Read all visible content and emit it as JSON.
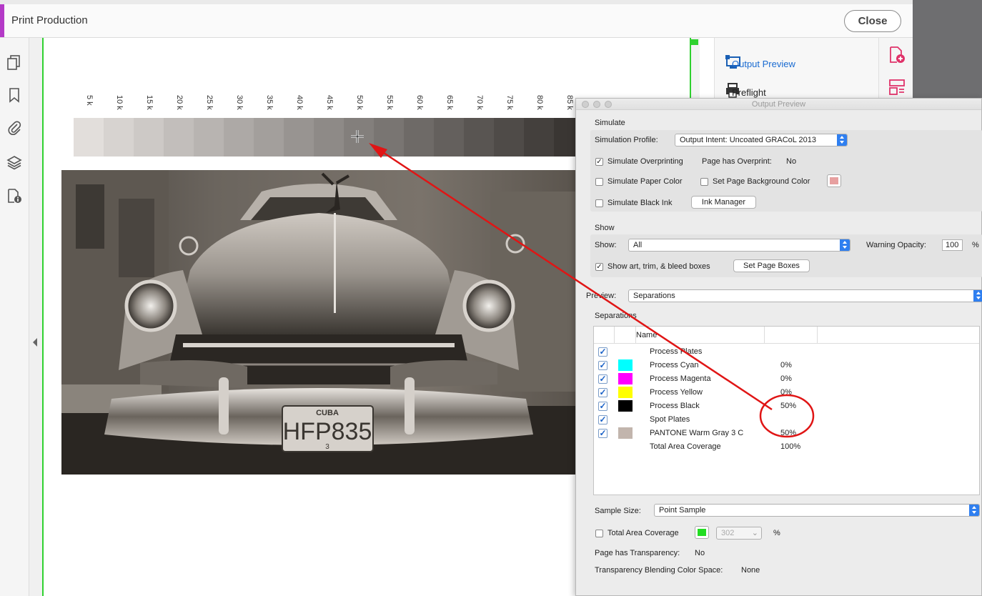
{
  "app": {
    "title": "Print Production",
    "close_label": "Close"
  },
  "left_toolbar": {
    "icons": [
      "pages-icon",
      "bookmark-icon",
      "attachment-icon",
      "layers-icon",
      "document-info-icon"
    ]
  },
  "right_panel": {
    "items": [
      {
        "label": "Output Preview",
        "icon": "output-preview-icon",
        "active": true
      },
      {
        "label": "Preflight",
        "icon": "preflight-icon",
        "active": false
      }
    ]
  },
  "document": {
    "ramp_labels": [
      "5 k",
      "10 k",
      "15 k",
      "20 k",
      "25 k",
      "30 k",
      "35 k",
      "40 k",
      "45 k",
      "50 k",
      "55 k",
      "60 k",
      "65 k",
      "70 k",
      "75 k",
      "80 k",
      "85 k"
    ],
    "plate_text_top": "CUBA",
    "plate_text_main": "HFP835",
    "plate_text_bottom": "3"
  },
  "dialog": {
    "title": "Output Preview",
    "simulate": {
      "title": "Simulate",
      "profile_label": "Simulation Profile:",
      "profile_value": "Output Intent: Uncoated GRACoL 2013",
      "simulate_overprinting_label": "Simulate Overprinting",
      "simulate_overprinting_checked": true,
      "page_has_overprint_label": "Page has Overprint:",
      "page_has_overprint_value": "No",
      "simulate_paper_color_label": "Simulate Paper Color",
      "set_page_bg_label": "Set Page Background Color",
      "bg_swatch_color": "#e7a0a0",
      "simulate_black_ink_label": "Simulate Black Ink",
      "ink_manager_label": "Ink Manager"
    },
    "show": {
      "title": "Show",
      "show_label": "Show:",
      "show_value": "All",
      "warning_opacity_label": "Warning Opacity:",
      "warning_opacity_value": "100",
      "percent": "%",
      "show_art_label": "Show art, trim, & bleed boxes",
      "show_art_checked": true,
      "set_page_boxes_label": "Set Page Boxes"
    },
    "preview": {
      "label": "Preview:",
      "value": "Separations"
    },
    "separations": {
      "title": "Separations",
      "name_header": "Name",
      "rows": [
        {
          "name": "Process Plates",
          "value": "",
          "color": "",
          "checked": true
        },
        {
          "name": "Process Cyan",
          "value": "0%",
          "color": "#00ffff",
          "checked": true
        },
        {
          "name": "Process Magenta",
          "value": "0%",
          "color": "#ff00ff",
          "checked": true
        },
        {
          "name": "Process Yellow",
          "value": "0%",
          "color": "#ffff00",
          "checked": true
        },
        {
          "name": "Process Black",
          "value": "50%",
          "color": "#000000",
          "checked": true
        },
        {
          "name": "Spot Plates",
          "value": "",
          "color": "",
          "checked": true
        },
        {
          "name": "PANTONE Warm Gray 3 C",
          "value": "50%",
          "color": "#c2b5ad",
          "checked": true
        },
        {
          "name": "Total Area Coverage",
          "value": "100%",
          "color": "",
          "checked": false
        }
      ]
    },
    "sample_size": {
      "label": "Sample Size:",
      "value": "Point Sample"
    },
    "total_area_coverage": {
      "label": "Total Area Coverage",
      "checked": false,
      "swatch_color": "#22dd22",
      "value": "302",
      "percent": "%"
    },
    "transparency": {
      "label": "Page has Transparency:",
      "value": "No"
    },
    "blending": {
      "label": "Transparency Blending Color Space:",
      "value": "None"
    }
  },
  "annotation": {
    "color": "#e01515"
  }
}
